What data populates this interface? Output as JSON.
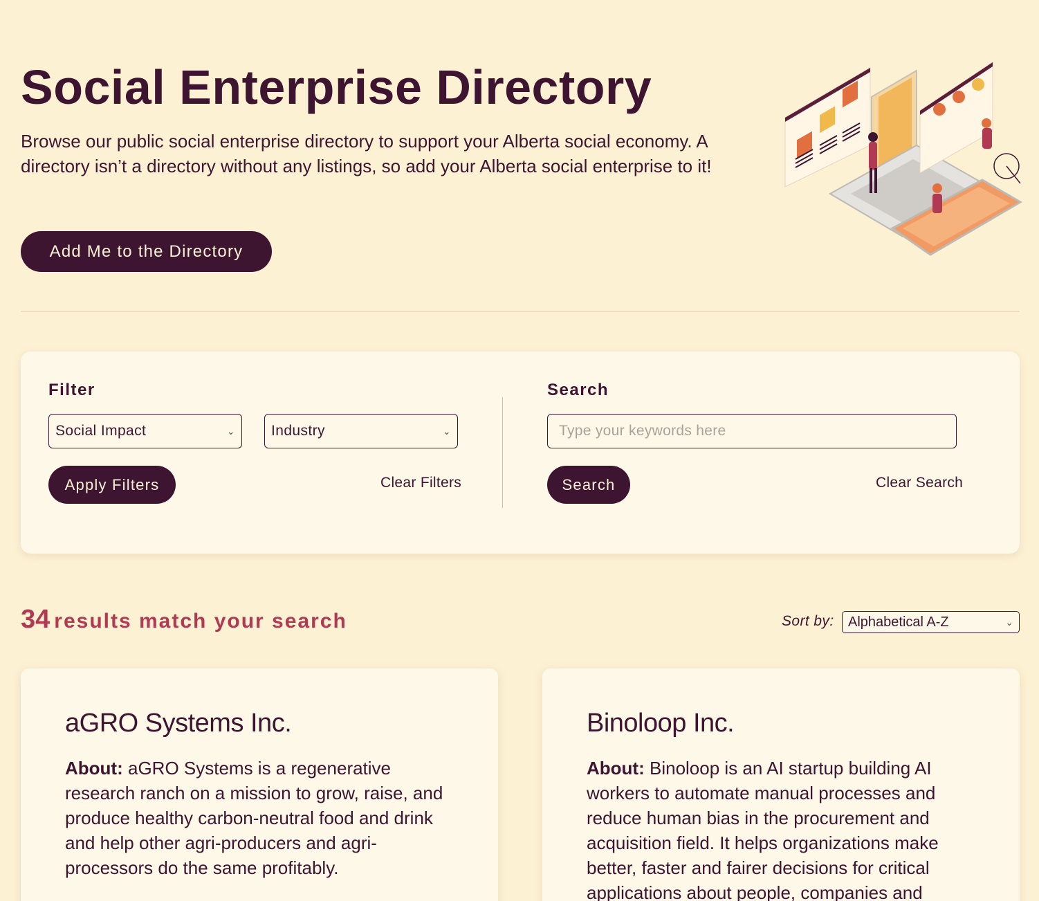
{
  "hero": {
    "title": "Social Enterprise Directory",
    "description": "Browse our public social enterprise directory to support your Alberta social economy. A directory isn’t a directory without any listings, so add your Alberta social enterprise to it!",
    "add_button": "Add Me to the Directory",
    "illustration_icon": "people-directory-laptop-illustration"
  },
  "filter": {
    "heading": "Filter",
    "social_impact": "Social Impact",
    "industry": "Industry",
    "apply": "Apply Filters",
    "clear": "Clear Filters"
  },
  "search": {
    "heading": "Search",
    "placeholder": "Type your keywords here",
    "button": "Search",
    "clear": "Clear Search"
  },
  "results": {
    "count": "34",
    "text": "results match your search",
    "sort_label": "Sort by:",
    "sort_value": "Alphabetical A-Z"
  },
  "cards": [
    {
      "title": "aGRO Systems Inc.",
      "about_label": "About:",
      "about": "aGRO Systems is a regenerative research ranch on a mission to grow, raise, and produce healthy carbon-neutral food and drink and help other agri-producers and agri-processors do the same profitably."
    },
    {
      "title": "Binoloop Inc.",
      "about_label": "About:",
      "about": "Binoloop is an AI startup building AI workers to automate manual processes and reduce human bias in the procurement and acquisition field. It helps organizations make better, faster and fairer decisions for critical applications about people, companies and"
    }
  ],
  "colors": {
    "background": "#fdf1d4",
    "primary": "#3d1530",
    "accent": "#b03a52",
    "panel": "#fef8e8"
  }
}
